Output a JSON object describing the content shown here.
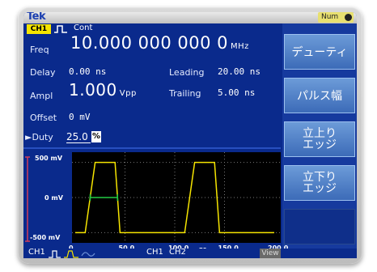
{
  "brand": "Tek",
  "indicator": {
    "label": "Num"
  },
  "channel": {
    "tag": "CH1",
    "mode": "Cont"
  },
  "params": {
    "freq": {
      "label": "Freq",
      "value": "10.000 000 000 0",
      "unit": "MHz"
    },
    "delay": {
      "label": "Delay",
      "value": "0.00",
      "unit": "ns"
    },
    "leading": {
      "label": "Leading",
      "value": "20.00",
      "unit": "ns"
    },
    "ampl": {
      "label": "Ampl",
      "value": "1.000",
      "unit": "Vpp"
    },
    "trailing": {
      "label": "Trailing",
      "value": "5.00",
      "unit": "ns"
    },
    "offset": {
      "label": "Offset",
      "value": "0",
      "unit": "mV"
    },
    "duty": {
      "label": "Duty",
      "value": "25.0",
      "unit": "%",
      "marker": "►"
    }
  },
  "softkeys": [
    {
      "label": "デューティ"
    },
    {
      "label": "パルス幅"
    },
    {
      "label": "立上り\nエッジ"
    },
    {
      "label": "立下り\nエッジ"
    }
  ],
  "chart_data": {
    "type": "line",
    "x": [
      0,
      10,
      20,
      40,
      45,
      50,
      100,
      110,
      120,
      140,
      145,
      150,
      200
    ],
    "y": [
      -500,
      -500,
      500,
      500,
      -500,
      -500,
      -500,
      -500,
      500,
      500,
      -500,
      -500,
      -500
    ],
    "xlabel": "ns",
    "ylabel": "",
    "x_ticks": [
      "0",
      "50.0",
      "100.0",
      "150.0",
      "200.0"
    ],
    "y_ticks": [
      "500 mV",
      "0 mV",
      "-500 mV"
    ],
    "xlim": [
      0,
      200
    ],
    "ylim": [
      -600,
      600
    ],
    "grid": true
  },
  "bottom": {
    "ch1": "CH1",
    "ch1b": "CH1",
    "ch2": "CH2",
    "view": "View"
  },
  "colors": {
    "trace": "#f5e400",
    "marker": "#22cc44",
    "screen": "#0a2a8c",
    "highlight": "#f5e400"
  }
}
